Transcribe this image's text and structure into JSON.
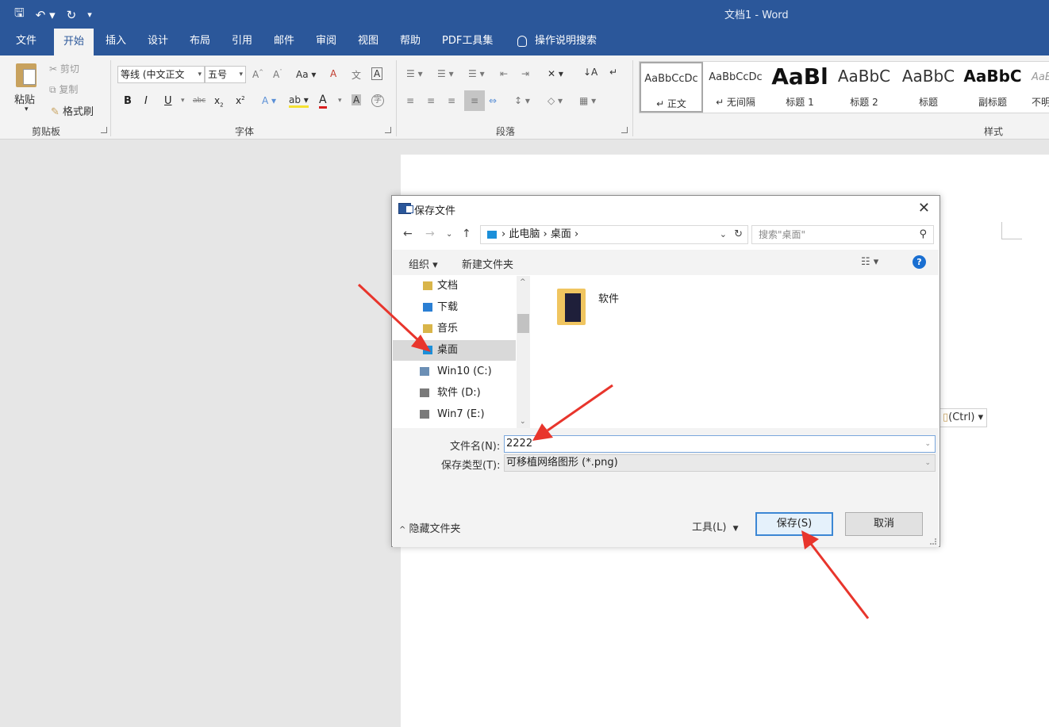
{
  "window": {
    "title": "文档1  -  Word"
  },
  "ribbon_tabs": [
    "文件",
    "开始",
    "插入",
    "设计",
    "布局",
    "引用",
    "邮件",
    "审阅",
    "视图",
    "帮助",
    "PDF工具集"
  ],
  "active_tab": "开始",
  "tell_me": "操作说明搜索",
  "clipboard": {
    "paste": "粘贴",
    "cut": "剪切",
    "copy": "复制",
    "format_painter": "格式刷",
    "group": "剪贴板"
  },
  "font": {
    "name": "等线 (中文正文",
    "size": "五号",
    "group": "字体",
    "case": "Aa"
  },
  "paragraph": {
    "group": "段落"
  },
  "styles": {
    "group": "样式",
    "items": [
      {
        "preview": "AaBbCcDc",
        "name": "↵ 正文"
      },
      {
        "preview": "AaBbCcDc",
        "name": "↵ 无间隔"
      },
      {
        "preview": "AaBl",
        "name": "标题 1"
      },
      {
        "preview": "AaBbC",
        "name": "标题 2"
      },
      {
        "preview": "AaBbC",
        "name": "标题"
      },
      {
        "preview": "AaBbC",
        "name": "副标题"
      },
      {
        "preview": "AaB",
        "name": "不明"
      }
    ]
  },
  "ctrl_tag": "(Ctrl) ▾",
  "dialog": {
    "title": "保存文件",
    "breadcrumb": [
      "此电脑",
      "桌面"
    ],
    "search_placeholder": "搜索\"桌面\"",
    "toolbar": {
      "organize": "组织 ▾",
      "new_folder": "新建文件夹"
    },
    "nav_items": [
      {
        "label": "文档",
        "color": "#d9b54a"
      },
      {
        "label": "下载",
        "color": "#2a7fd4"
      },
      {
        "label": "音乐",
        "color": "#d9b54a"
      },
      {
        "label": "桌面",
        "color": "#1b8fd9"
      },
      {
        "label": "Win10 (C:)",
        "color": "#6b8fb5"
      },
      {
        "label": "软件 (D:)",
        "color": "#7a7a7a"
      },
      {
        "label": "Win7 (E:)",
        "color": "#7a7a7a"
      }
    ],
    "selected_nav": "桌面",
    "files": [
      {
        "name": "软件",
        "kind": "folder"
      }
    ],
    "filename_label": "文件名(N):",
    "filename_value": "2222",
    "filetype_label": "保存类型(T):",
    "filetype_value": "可移植网络图形 (*.png)",
    "hide_folders": "隐藏文件夹",
    "tools": "工具(L)",
    "save": "保存(S)",
    "cancel": "取消"
  },
  "colors": {
    "brand": "#2b579a",
    "annotation": "#e8352c"
  }
}
